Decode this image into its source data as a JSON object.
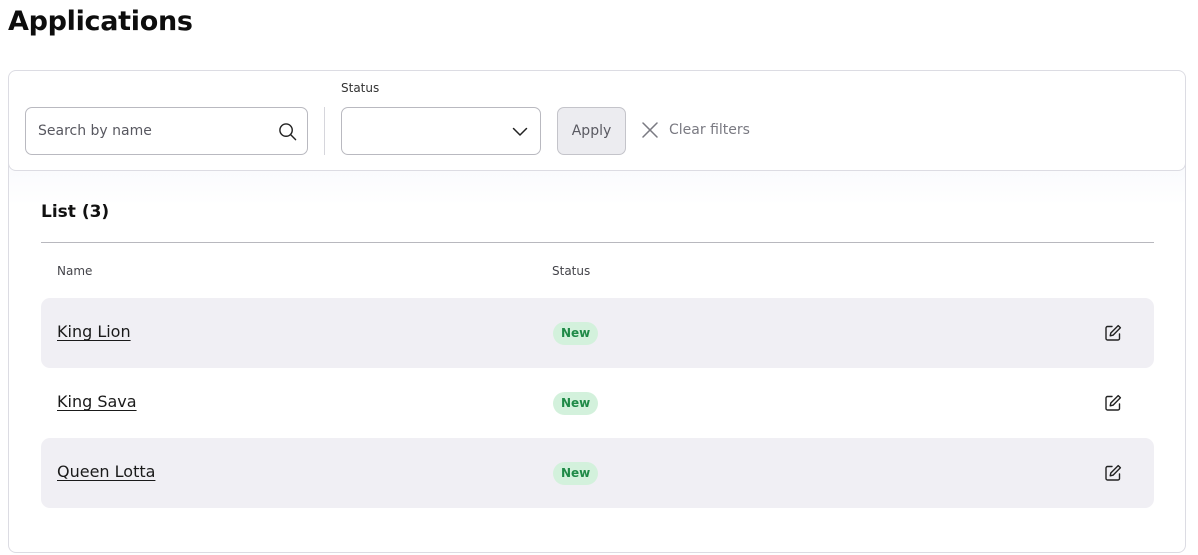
{
  "page": {
    "title": "Applications"
  },
  "filters": {
    "search_placeholder": "Search by name",
    "search_value": "",
    "status_label": "Status",
    "status_value": "",
    "apply_label": "Apply",
    "clear_label": "Clear filters",
    "icons": {
      "search": "search-icon",
      "dropdown": "chevron-down-icon",
      "clear": "close-icon"
    }
  },
  "list": {
    "title": "List (3)",
    "columns": {
      "name": "Name",
      "status": "Status"
    },
    "rows": [
      {
        "name": "King Lion",
        "status": "New"
      },
      {
        "name": "King Sava",
        "status": "New"
      },
      {
        "name": "Queen Lotta",
        "status": "New"
      }
    ],
    "row_icon": "edit-icon"
  },
  "colors": {
    "row_shade": "#f0eff4",
    "badge_bg": "#d3f1dc",
    "badge_text": "#1f8a47",
    "apply_bg": "#ececf0"
  }
}
